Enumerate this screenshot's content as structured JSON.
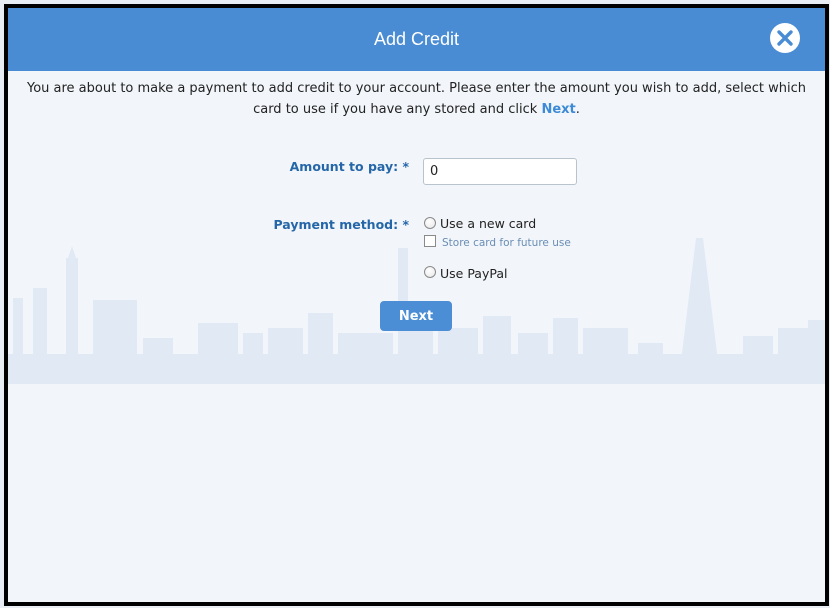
{
  "dialog": {
    "title": "Add Credit",
    "intro_text": "You are about to make a payment to add credit to your account. Please enter the amount you wish to add, select which card to use if you have any stored and click",
    "intro_link": "Next",
    "intro_suffix": "."
  },
  "form": {
    "amount_label": "Amount to pay: *",
    "amount_value": "0",
    "payment_method_label": "Payment method: *",
    "option_new_card": "Use a new card",
    "store_card_label": "Store card for future use",
    "option_paypal": "Use PayPal",
    "next_label": "Next"
  },
  "icons": {
    "close": "close-icon"
  },
  "colors": {
    "header": "#4a8cd3",
    "label": "#2566a8",
    "button": "#4b8ed6"
  }
}
